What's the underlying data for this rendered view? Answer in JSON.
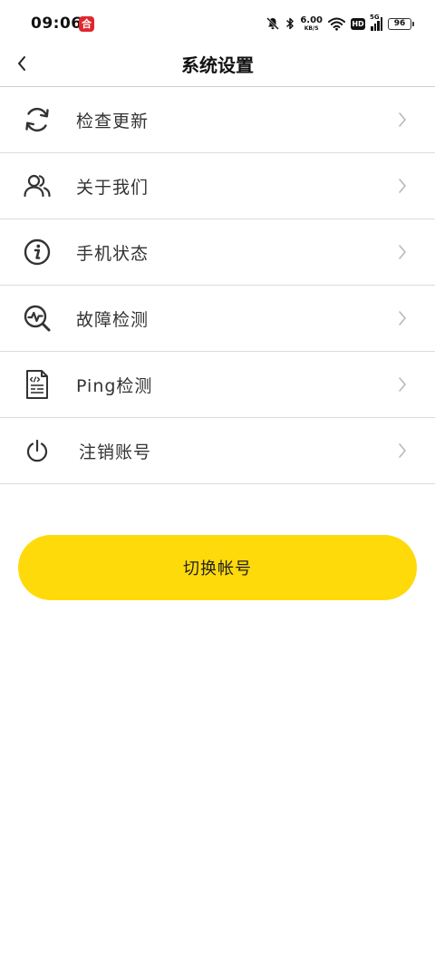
{
  "status_bar": {
    "time": "09:06",
    "app_badge": "合",
    "net_speed_value": "6.00",
    "net_speed_unit": "KB/S",
    "hd_label": "HD",
    "signal_label": "5G",
    "battery_level": "96"
  },
  "header": {
    "title": "系统设置"
  },
  "menu": {
    "items": [
      {
        "label": "检查更新",
        "icon": "refresh-icon"
      },
      {
        "label": "关于我们",
        "icon": "users-icon"
      },
      {
        "label": "手机状态",
        "icon": "info-icon"
      },
      {
        "label": "故障检测",
        "icon": "diagnostic-search-icon"
      },
      {
        "label": "Ping检测",
        "icon": "code-document-icon"
      },
      {
        "label": "注销账号",
        "icon": "power-icon"
      }
    ]
  },
  "actions": {
    "switch_account_label": "切换帐号"
  },
  "colors": {
    "accent": "#ffda0a",
    "icon": "#333333",
    "divider": "#dcdcdc",
    "chevron": "#b8b8b8"
  }
}
